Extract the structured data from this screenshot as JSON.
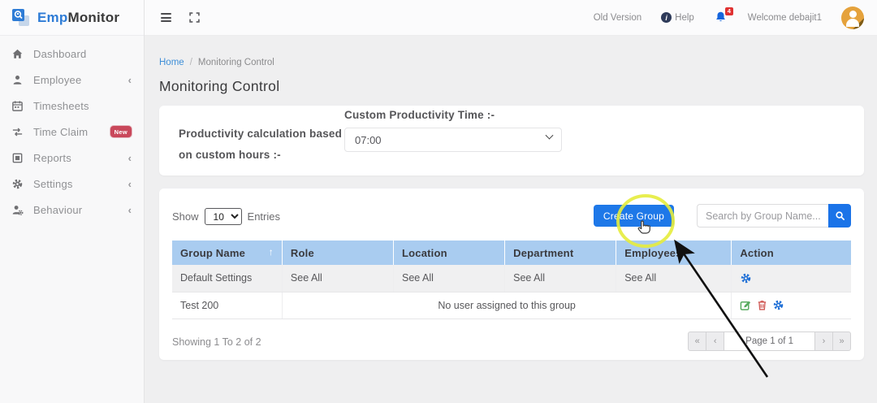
{
  "logo": {
    "text_primary": "Emp",
    "text_secondary": "Monitor"
  },
  "topbar": {
    "old_version_label": "Old Version",
    "help_label": "Help",
    "notification_count": "4",
    "welcome_text": "Welcome debajit1"
  },
  "sidebar": {
    "items": [
      {
        "label": "Dashboard"
      },
      {
        "label": "Employee",
        "chevron": "‹"
      },
      {
        "label": "Timesheets"
      },
      {
        "label": "Time Claim",
        "badge": "New"
      },
      {
        "label": "Reports",
        "chevron": "‹"
      },
      {
        "label": "Settings",
        "chevron": "‹"
      },
      {
        "label": "Behaviour",
        "chevron": "‹"
      }
    ]
  },
  "breadcrumb": {
    "home": "Home",
    "separator": "/",
    "current": "Monitoring Control"
  },
  "page_title": "Monitoring Control",
  "productivity": {
    "label": "Productivity calculation based on custom hours :-",
    "time_label": "Custom Productivity Time :-",
    "time_value": "07:00"
  },
  "groups": {
    "show_label": "Show",
    "page_size": "10",
    "entries_label": "Entries",
    "create_group_label": "Create Group",
    "search_placeholder": "Search by Group Name...",
    "headers": [
      "Group Name",
      "Role",
      "Location",
      "Department",
      "Employees",
      "Action"
    ],
    "sort_indicator": "↑",
    "rows": {
      "default": {
        "name": "Default Settings",
        "role": "See All",
        "location": "See All",
        "department": "See All",
        "employees": "See All"
      },
      "test": {
        "name": "Test 200",
        "message": "No user assigned to this group"
      }
    },
    "footer": {
      "summary": "Showing 1 To 2 of 2",
      "first": "«",
      "prev": "‹",
      "page_indicator": "Page 1 of 1",
      "next": "›",
      "last": "»"
    }
  },
  "colors": {
    "accent_blue": "#1e78e8",
    "table_header_blue": "#a9ccf0",
    "badge_red": "#c9485b",
    "highlight_yellow": "#e6ec3c"
  }
}
